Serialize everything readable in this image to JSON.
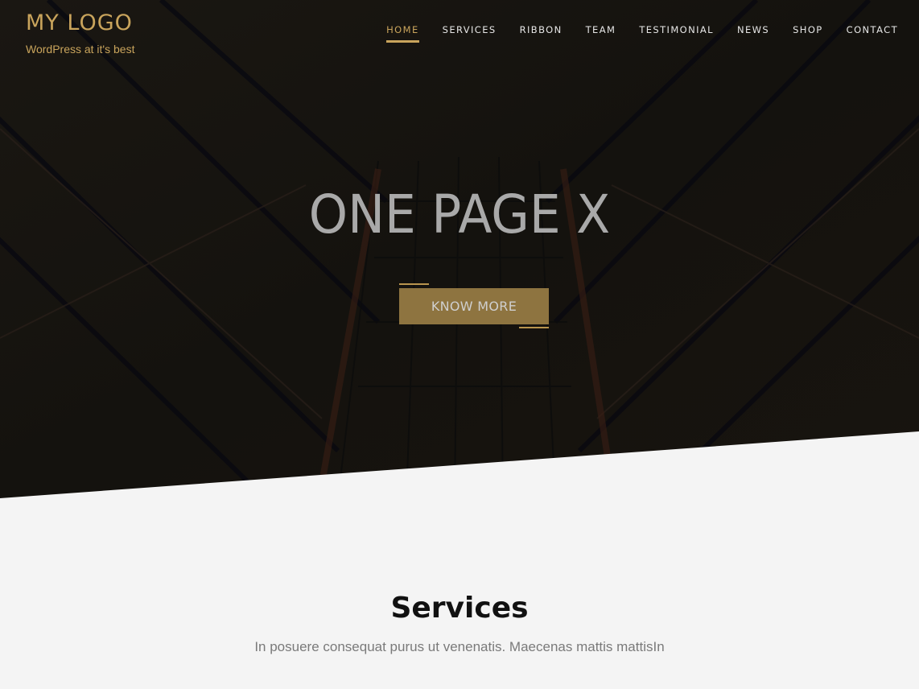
{
  "header": {
    "logo_title": "MY LOGO",
    "logo_tagline": "WordPress at it's best"
  },
  "nav": {
    "items": [
      {
        "label": "HOME",
        "active": true
      },
      {
        "label": "SERVICES",
        "active": false
      },
      {
        "label": "RIBBON",
        "active": false
      },
      {
        "label": "TEAM",
        "active": false
      },
      {
        "label": "TESTIMONIAL",
        "active": false
      },
      {
        "label": "NEWS",
        "active": false
      },
      {
        "label": "SHOP",
        "active": false
      },
      {
        "label": "CONTACT",
        "active": false
      }
    ]
  },
  "hero": {
    "title": "ONE PAGE X",
    "button_label": "KNOW MORE"
  },
  "services": {
    "heading": "Services",
    "subtitle": "In posuere consequat purus ut venenatis. Maecenas mattis mattisIn"
  },
  "colors": {
    "accent": "#c9a45c",
    "button_bg": "#8e7440",
    "hero_bg": "#141210",
    "section_bg": "#f4f4f4"
  }
}
